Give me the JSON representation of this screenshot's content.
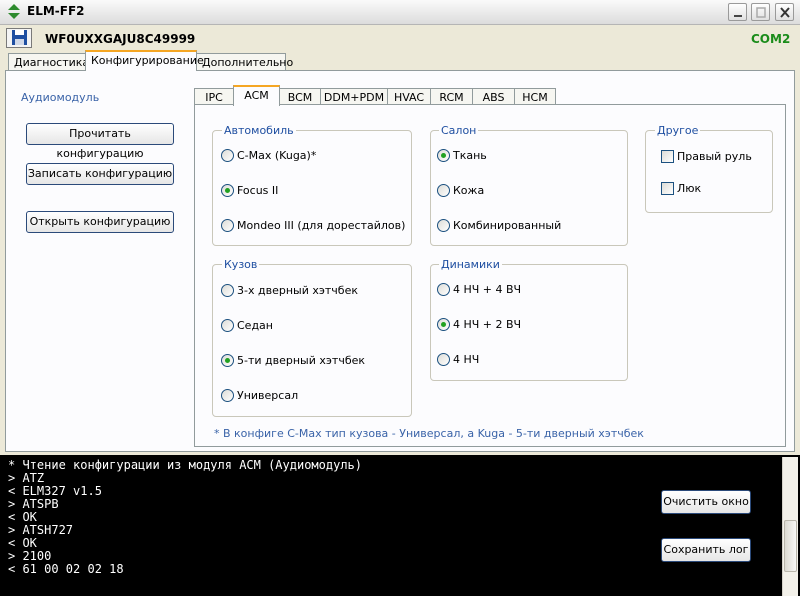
{
  "window": {
    "title": "ELM-FF2"
  },
  "toolbar": {
    "vin": "WF0UXXGAJU8C49999",
    "port": "COM2"
  },
  "outer_tabs": [
    "Диагностика",
    "Конфигурирование",
    "Дополнительно"
  ],
  "left": {
    "module_label": "Аудиомодуль",
    "read_button": "Прочитать конфигурацию",
    "write_button": "Записать конфигурацию",
    "open_button": "Открыть конфигурацию"
  },
  "inner_tabs": [
    "IPC",
    "ACM",
    "BCM",
    "DDM+PDM",
    "HVAC",
    "RCM",
    "ABS",
    "HCM"
  ],
  "groups": {
    "car": {
      "label": "Автомобиль",
      "options": [
        "C-Max (Kuga)*",
        "Focus II",
        "Mondeo III (для дорестайлов)"
      ],
      "selected": "Focus II"
    },
    "salon": {
      "label": "Салон",
      "options": [
        "Ткань",
        "Кожа",
        "Комбинированный"
      ],
      "selected": "Ткань"
    },
    "other": {
      "label": "Другое",
      "options": [
        "Правый руль",
        "Люк"
      ]
    },
    "body": {
      "label": "Кузов",
      "options": [
        "3-х дверный хэтчбек",
        "Седан",
        "5-ти дверный хэтчбек",
        "Универсал"
      ],
      "selected": "5-ти дверный хэтчбек"
    },
    "speakers": {
      "label": "Динамики",
      "options": [
        "4 НЧ + 4 ВЧ",
        "4 НЧ + 2 ВЧ",
        "4 НЧ"
      ],
      "selected": "4 НЧ + 2 ВЧ"
    }
  },
  "note": "* В конфиге C-Max тип кузова - Универсал, а Kuga - 5-ти дверный хэтчбек",
  "console": {
    "lines": [
      "* Чтение конфигурации из модуля ACM (Аудиомодуль)",
      "> ATZ",
      "< ELM327 v1.5",
      "> ATSPB",
      "< OK",
      "> ATSH727",
      "< OK",
      "> 2100",
      "< 61 00 02 02 18"
    ],
    "clear_button": "Очистить окно",
    "save_button": "Сохранить лог"
  },
  "colors": {
    "active_tab_accent": "#f5a623",
    "group_label": "#1f4fa1",
    "port_status": "#1a8c1a",
    "console_bg": "#000000"
  }
}
